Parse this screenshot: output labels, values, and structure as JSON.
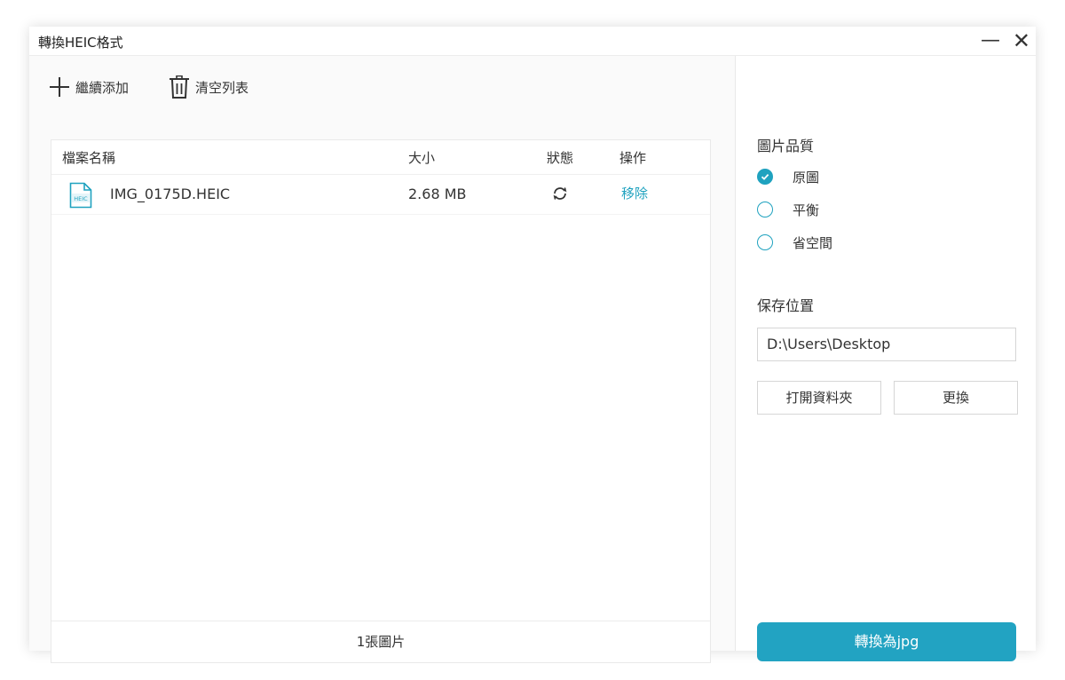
{
  "window": {
    "title": "轉換HEIC格式",
    "minimize_glyph": "—",
    "close_glyph": "✕"
  },
  "toolbar": {
    "add_label": "繼續添加",
    "add_icon": "plus-icon",
    "clear_label": "清空列表",
    "clear_icon": "trash-icon"
  },
  "table": {
    "columns": [
      "檔案名稱",
      "大小",
      "狀態",
      "操作"
    ],
    "rows": [
      {
        "icon": "heic-file-icon",
        "icon_text": "HEIC",
        "name": "IMG_0175D.HEIC",
        "size": "2.68 MB",
        "status_icon": "refresh-icon",
        "action": "移除"
      }
    ],
    "footer": "1張圖片"
  },
  "quality": {
    "title": "圖片品質",
    "options": [
      {
        "label": "原圖",
        "selected": true
      },
      {
        "label": "平衡",
        "selected": false
      },
      {
        "label": "省空間",
        "selected": false
      }
    ]
  },
  "save": {
    "title": "保存位置",
    "path": "D:\\Users\\Desktop",
    "open_folder_label": "打開資料夾",
    "change_label": "更換"
  },
  "convert_label": "轉換為jpg",
  "colors": {
    "accent": "#22a3c2",
    "link": "#1fa2bf"
  }
}
